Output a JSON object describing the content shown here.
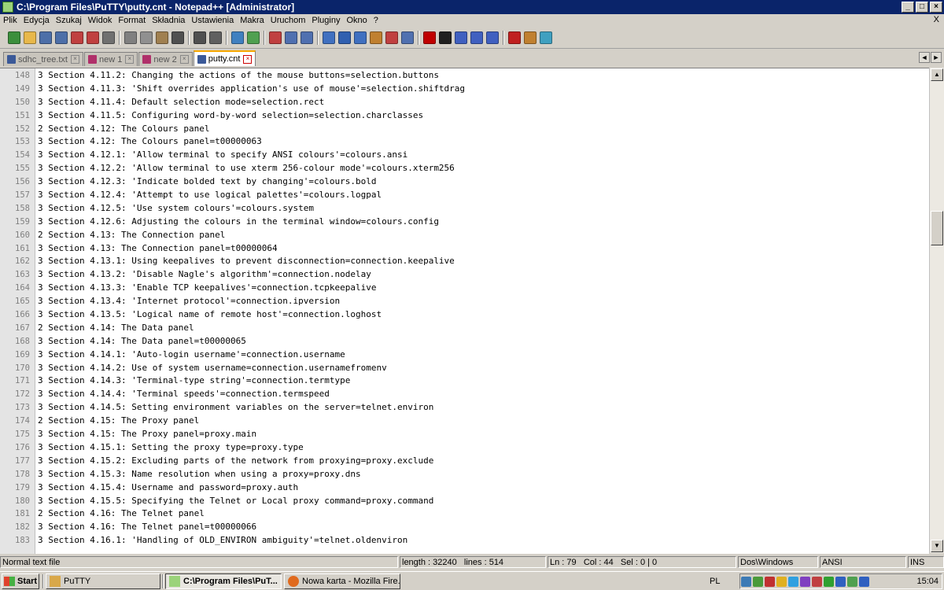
{
  "window": {
    "title": "C:\\Program Files\\PuTTY\\putty.cnt - Notepad++ [Administrator]",
    "min": "_",
    "max": "□",
    "close": "×"
  },
  "menu": [
    "Plik",
    "Edycja",
    "Szukaj",
    "Widok",
    "Format",
    "Składnia",
    "Ustawienia",
    "Makra",
    "Uruchom",
    "Pluginy",
    "Okno",
    "?"
  ],
  "menu_close": "X",
  "toolbar": {
    "icons": [
      "new-file-icon",
      "open-file-icon",
      "save-icon",
      "save-all-icon",
      "close-icon",
      "close-all-icon",
      "print-icon",
      "cut-icon",
      "copy-icon",
      "paste-icon",
      "undo-icon",
      "redo-icon",
      "find-icon",
      "replace-icon",
      "zoom-in-icon",
      "zoom-out-icon",
      "sync-vertical-icon",
      "sync-horizontal-icon",
      "word-wrap-icon",
      "show-all-chars-icon",
      "indent-guide-icon",
      "user-lang-icon",
      "doc-map-icon",
      "function-list-icon",
      "record-macro-icon",
      "stop-macro-icon",
      "play-macro-icon",
      "run-macro-multiple-icon",
      "save-macro-icon",
      "spellcheck-icon",
      "spellcheck-auto-icon",
      "spellcheck-options-icon"
    ],
    "colors": [
      "#3c8f3c",
      "#e8b84a",
      "#4d6fa8",
      "#4d6fa8",
      "#c04040",
      "#c04040",
      "#707070",
      "#808080",
      "#909090",
      "#a08050",
      "#505050",
      "#505050",
      "#606060",
      "#4080c0",
      "#50a050",
      "#c04040",
      "#5070b0",
      "#5070b0",
      "#4070c0",
      "#3060b0",
      "#4070c0",
      "#c08030",
      "#c04040",
      "#5070b0",
      "#c00000",
      "#202020",
      "#4060c0",
      "#4060c0",
      "#4060c0",
      "#c02020",
      "#c08030",
      "#40a0c0"
    ]
  },
  "tabs": [
    {
      "label": "sdhc_tree.txt",
      "unsaved": false,
      "active": false
    },
    {
      "label": "new 1",
      "unsaved": true,
      "active": false
    },
    {
      "label": "new 2",
      "unsaved": true,
      "active": false
    },
    {
      "label": "putty.cnt",
      "unsaved": false,
      "active": true
    }
  ],
  "tab_arrows": [
    "◄",
    "►"
  ],
  "lines": [
    {
      "n": "148",
      "t": "3 Section 4.11.2: Changing the actions of the mouse buttons=selection.buttons"
    },
    {
      "n": "149",
      "t": "3 Section 4.11.3: 'Shift overrides application's use of mouse'=selection.shiftdrag"
    },
    {
      "n": "150",
      "t": "3 Section 4.11.4: Default selection mode=selection.rect"
    },
    {
      "n": "151",
      "t": "3 Section 4.11.5: Configuring word-by-word selection=selection.charclasses"
    },
    {
      "n": "152",
      "t": "2 Section 4.12: The Colours panel"
    },
    {
      "n": "153",
      "t": "3 Section 4.12: The Colours panel=t00000063"
    },
    {
      "n": "154",
      "t": "3 Section 4.12.1: 'Allow terminal to specify ANSI colours'=colours.ansi"
    },
    {
      "n": "155",
      "t": "3 Section 4.12.2: 'Allow terminal to use xterm 256-colour mode'=colours.xterm256"
    },
    {
      "n": "156",
      "t": "3 Section 4.12.3: 'Indicate bolded text by changing'=colours.bold"
    },
    {
      "n": "157",
      "t": "3 Section 4.12.4: 'Attempt to use logical palettes'=colours.logpal"
    },
    {
      "n": "158",
      "t": "3 Section 4.12.5: 'Use system colours'=colours.system"
    },
    {
      "n": "159",
      "t": "3 Section 4.12.6: Adjusting the colours in the terminal window=colours.config"
    },
    {
      "n": "160",
      "t": "2 Section 4.13: The Connection panel"
    },
    {
      "n": "161",
      "t": "3 Section 4.13: The Connection panel=t00000064"
    },
    {
      "n": "162",
      "t": "3 Section 4.13.1: Using keepalives to prevent disconnection=connection.keepalive"
    },
    {
      "n": "163",
      "t": "3 Section 4.13.2: 'Disable Nagle's algorithm'=connection.nodelay"
    },
    {
      "n": "164",
      "t": "3 Section 4.13.3: 'Enable TCP keepalives'=connection.tcpkeepalive"
    },
    {
      "n": "165",
      "t": "3 Section 4.13.4: 'Internet protocol'=connection.ipversion"
    },
    {
      "n": "166",
      "t": "3 Section 4.13.5: 'Logical name of remote host'=connection.loghost"
    },
    {
      "n": "167",
      "t": "2 Section 4.14: The Data panel"
    },
    {
      "n": "168",
      "t": "3 Section 4.14: The Data panel=t00000065"
    },
    {
      "n": "169",
      "t": "3 Section 4.14.1: 'Auto-login username'=connection.username"
    },
    {
      "n": "170",
      "t": "3 Section 4.14.2: Use of system username=connection.usernamefromenv"
    },
    {
      "n": "171",
      "t": "3 Section 4.14.3: 'Terminal-type string'=connection.termtype"
    },
    {
      "n": "172",
      "t": "3 Section 4.14.4: 'Terminal speeds'=connection.termspeed"
    },
    {
      "n": "173",
      "t": "3 Section 4.14.5: Setting environment variables on the server=telnet.environ"
    },
    {
      "n": "174",
      "t": "2 Section 4.15: The Proxy panel"
    },
    {
      "n": "175",
      "t": "3 Section 4.15: The Proxy panel=proxy.main"
    },
    {
      "n": "176",
      "t": "3 Section 4.15.1: Setting the proxy type=proxy.type"
    },
    {
      "n": "177",
      "t": "3 Section 4.15.2: Excluding parts of the network from proxying=proxy.exclude"
    },
    {
      "n": "178",
      "t": "3 Section 4.15.3: Name resolution when using a proxy=proxy.dns"
    },
    {
      "n": "179",
      "t": "3 Section 4.15.4: Username and password=proxy.auth"
    },
    {
      "n": "180",
      "t": "3 Section 4.15.5: Specifying the Telnet or Local proxy command=proxy.command"
    },
    {
      "n": "181",
      "t": "2 Section 4.16: The Telnet panel"
    },
    {
      "n": "182",
      "t": "3 Section 4.16: The Telnet panel=t00000066"
    },
    {
      "n": "183",
      "t": "3 Section 4.16.1: 'Handling of OLD_ENVIRON ambiguity'=telnet.oldenviron"
    }
  ],
  "status": {
    "type": "Normal text file",
    "length": "length : 32240",
    "lines": "lines : 514",
    "ln": "Ln : 79",
    "col": "Col : 44",
    "sel": "Sel : 0 | 0",
    "eol": "Dos\\Windows",
    "encoding": "ANSI",
    "mode": "INS"
  },
  "taskbar": {
    "start": "Start",
    "tasks": [
      {
        "label": "PuTTY",
        "pressed": false,
        "icon_color": "#d9a84a"
      },
      {
        "label": "C:\\Program Files\\PuT...",
        "pressed": true,
        "icon_color": "#9bd37a"
      },
      {
        "label": "Nowa karta - Mozilla Fire...",
        "pressed": false,
        "icon_color": "#e06a1e"
      }
    ],
    "lang": "PL",
    "tray_icons": [
      "network-icon",
      "volume-icon",
      "antivirus-icon",
      "messenger-icon",
      "update-icon",
      "skype-icon",
      "display-icon",
      "security-icon",
      "bluetooth-icon",
      "usb-icon",
      "sync-icon"
    ],
    "tray_colors": [
      "#3c7ab5",
      "#4a9a3a",
      "#c03030",
      "#e0b020",
      "#30a0e0",
      "#8040c0",
      "#c04040",
      "#30a030",
      "#3060c0",
      "#50a050",
      "#3060c0"
    ],
    "clock": "15:04"
  }
}
